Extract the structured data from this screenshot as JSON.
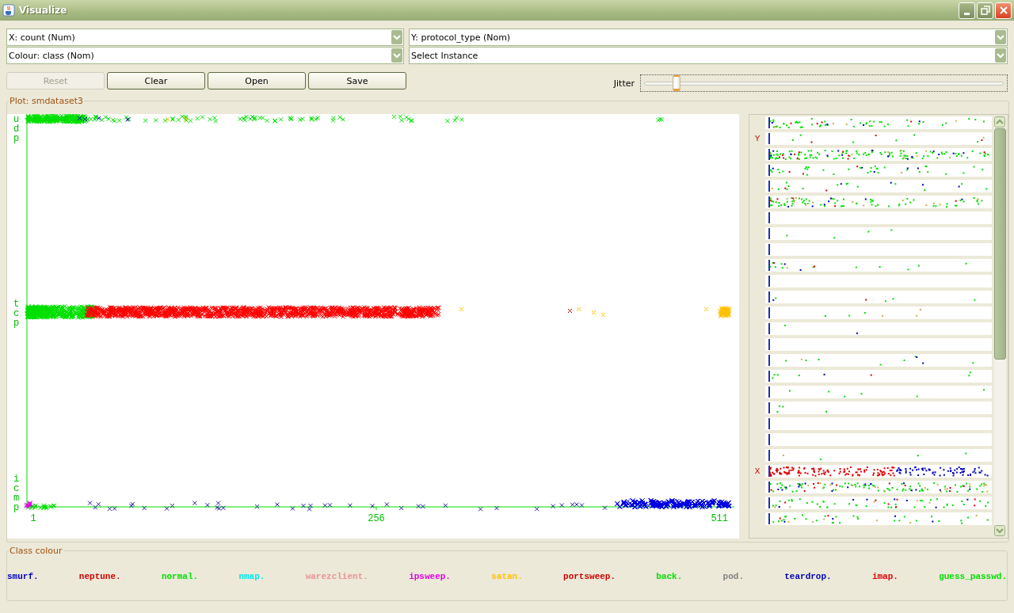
{
  "window": {
    "title": "Visualize"
  },
  "selectors": [
    {
      "kind": "combo",
      "text": "X: count (Num)"
    },
    {
      "kind": "combo",
      "text": "Y: protocol_type (Nom)"
    },
    {
      "kind": "combo",
      "text": "Colour: class (Nom)"
    },
    {
      "kind": "combo",
      "text": "Select Instance"
    }
  ],
  "buttons": [
    {
      "label": "Reset",
      "disabled": true
    },
    {
      "label": "Clear",
      "disabled": false
    },
    {
      "label": "Open",
      "disabled": false
    },
    {
      "label": "Save",
      "disabled": false
    }
  ],
  "jitter": {
    "label": "Jitter",
    "level": 0.08
  },
  "plot": {
    "title": "Plot: smdataset3",
    "y_categories": [
      "udp",
      "tcp",
      "icmp"
    ],
    "x_ticks": [
      "1",
      "256",
      "511"
    ]
  },
  "attribute_panel": {
    "y_marker": "Y",
    "x_marker": "X"
  },
  "class_colour": {
    "title": "Class colour",
    "classes": [
      {
        "name": "smurf.",
        "color": "#0000c0"
      },
      {
        "name": "neptune.",
        "color": "#d00000"
      },
      {
        "name": "normal.",
        "color": "#00e000"
      },
      {
        "name": "nmap.",
        "color": "#00e8e8"
      },
      {
        "name": "warezclient.",
        "color": "#e89494"
      },
      {
        "name": "ipsweep.",
        "color": "#e000e0"
      },
      {
        "name": "satan.",
        "color": "#ffc000"
      },
      {
        "name": "portsweep.",
        "color": "#cc0000"
      },
      {
        "name": "back.",
        "color": "#00e000"
      },
      {
        "name": "pod.",
        "color": "#808080"
      },
      {
        "name": "teardrop.",
        "color": "#0000b0"
      },
      {
        "name": "imap.",
        "color": "#e00000"
      },
      {
        "name": "guess_passwd.",
        "color": "#00e000"
      }
    ]
  }
}
